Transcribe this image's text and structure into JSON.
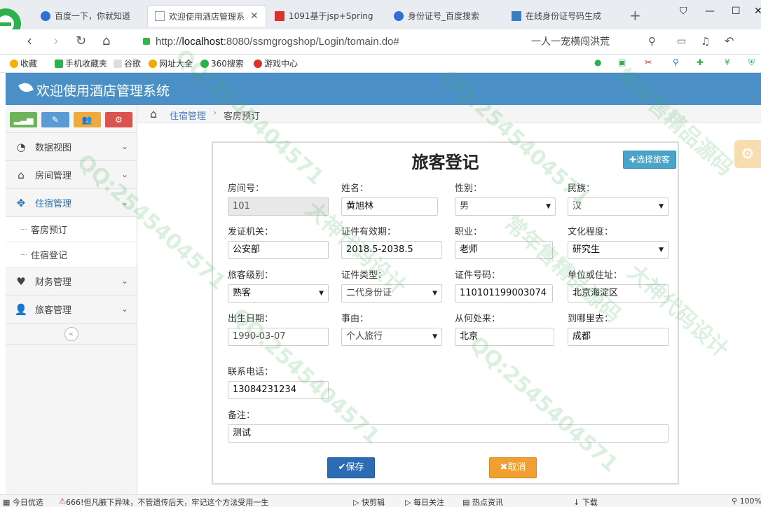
{
  "browser": {
    "tabs": [
      {
        "label": "百度一下，你就知道",
        "active": false
      },
      {
        "label": "欢迎使用酒店管理系",
        "active": true
      },
      {
        "label": "1091基于jsp+Spring",
        "active": false
      },
      {
        "label": "身份证号_百度搜索",
        "active": false
      },
      {
        "label": "在线身份证号码生成",
        "active": false
      }
    ],
    "url_prefix": "http://",
    "url_host": "localhost",
    "url_rest": ":8080/ssmgrogshop/Login/tomain.do#",
    "search_text": "一人一宠横闯洪荒",
    "bookmarks": [
      "收藏",
      "手机收藏夹",
      "谷歌",
      "网址大全",
      "360搜索",
      "游戏中心"
    ]
  },
  "app": {
    "title": "欢迎使用酒店管理系统",
    "accent": "#4a90c6"
  },
  "sidebar": {
    "shortcut_colors": [
      "#6cb35a",
      "#5b9bd5",
      "#f0a93a",
      "#d9534f"
    ],
    "items": [
      {
        "label": "数据视图",
        "icon": "dashboard-icon"
      },
      {
        "label": "房间管理",
        "icon": "home-icon"
      },
      {
        "label": "住宿管理",
        "icon": "move-icon"
      },
      {
        "label": "财务管理",
        "icon": "heart-icon"
      },
      {
        "label": "旅客管理",
        "icon": "user-icon"
      }
    ],
    "subitems": [
      "客房预订",
      "住宿登记"
    ]
  },
  "breadcrumb": {
    "parent": "住宿管理",
    "current": "客房预订"
  },
  "form": {
    "title": "旅客登记",
    "pick_button": "选择旅客",
    "labels": {
      "room": "房间号：",
      "name": "姓名：",
      "gender": "性别：",
      "ethnicity": "民族：",
      "issuer": "发证机关：",
      "validity": "证件有效期：",
      "job": "职业：",
      "education": "文化程度：",
      "level": "旅客级别：",
      "id_type": "证件类型：",
      "id_number": "证件号码：",
      "address": "单位或住址：",
      "birth": "出生日期：",
      "reason": "事由：",
      "from": "从何处来：",
      "to": "到哪里去：",
      "phone": "联系电话：",
      "remark": "备注："
    },
    "values": {
      "room": "101",
      "name": "黄旭林",
      "gender": "男",
      "ethnicity": "汉",
      "issuer": "公安部",
      "validity": "2018.5-2038.5",
      "job": "老师",
      "education": "研究生",
      "level": "熟客",
      "id_type": "二代身份证",
      "id_number": "110101199003074",
      "address": "北京海淀区",
      "birth": "1990-03-07",
      "reason": "个人旅行",
      "from": "北京",
      "to": "成都",
      "phone": "13084231234",
      "remark": "测试"
    },
    "save_label": "保存",
    "cancel_label": "取消"
  },
  "statusbar": {
    "left": "今日优选",
    "news": "666!但凡腋下异味，不管遗传后天，牢记这个方法受用一生",
    "items": [
      "快剪辑",
      "每日关注",
      "热点资讯",
      "下载"
    ],
    "zoom": "100%"
  },
  "watermark": {
    "texts": [
      "QQ:2545404571",
      "常年售精品源码",
      "大神代码设计"
    ]
  }
}
